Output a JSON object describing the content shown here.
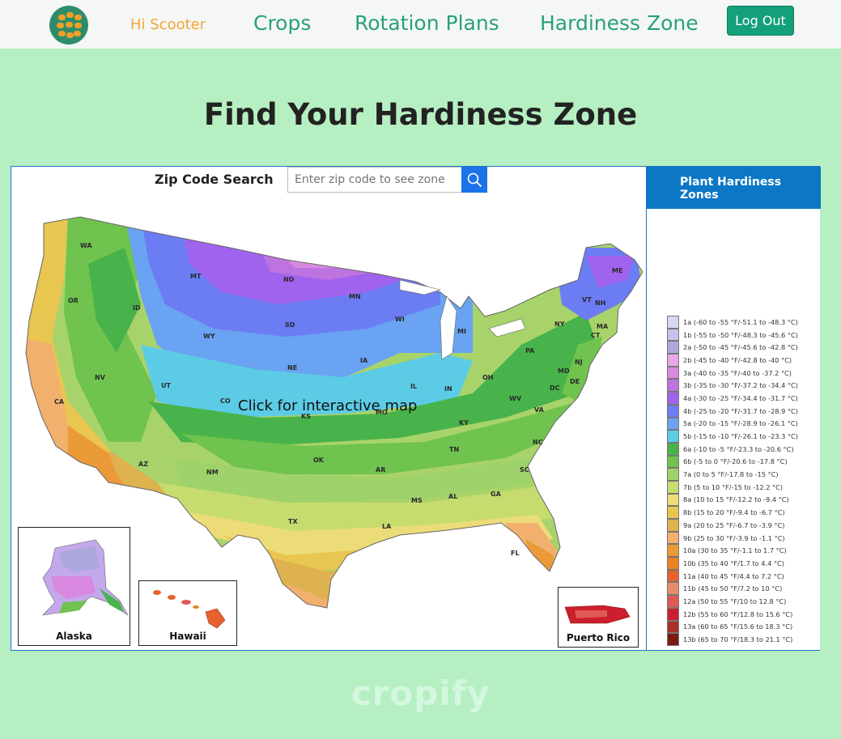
{
  "nav": {
    "greeting": "Hi Scooter",
    "links": [
      "Crops",
      "Rotation Plans",
      "Hardiness Zone"
    ],
    "logout_label": "Log Out"
  },
  "page": {
    "title": "Find Your Hardiness Zone"
  },
  "map": {
    "zip_label": "Zip Code Search",
    "zip_placeholder": "Enter zip code to see zone",
    "cta": "Click for interactive map",
    "insets": [
      "Alaska",
      "Hawaii",
      "Puerto Rico"
    ],
    "state_labels": [
      "WA",
      "OR",
      "CA",
      "NV",
      "ID",
      "MT",
      "WY",
      "UT",
      "AZ",
      "CO",
      "NM",
      "ND",
      "SD",
      "NE",
      "KS",
      "OK",
      "TX",
      "MN",
      "IA",
      "MO",
      "AR",
      "LA",
      "WI",
      "IL",
      "MS",
      "MI",
      "IN",
      "KY",
      "TN",
      "AL",
      "OH",
      "GA",
      "FL",
      "SC",
      "NC",
      "VA",
      "WV",
      "PA",
      "NY",
      "VT",
      "NH",
      "ME",
      "MA",
      "CT",
      "NJ",
      "DE",
      "MD",
      "DC"
    ]
  },
  "legend": {
    "title": "Plant Hardiness Zones",
    "items": [
      {
        "label": "1a (-60 to -55 °F/-51.1 to -48.3 °C)",
        "color": "#d6d8f3"
      },
      {
        "label": "1b (-55 to -50 °F/-48.3 to -45.6 °C)",
        "color": "#c4c4ea"
      },
      {
        "label": "2a (-50 to -45 °F/-45.6 to -42.8 °C)",
        "color": "#ada8dc"
      },
      {
        "label": "2b (-45 to -40 °F/-42.8 to -40 °C)",
        "color": "#e8a6e4"
      },
      {
        "label": "3a (-40 to -35 °F/-40 to -37.2 °C)",
        "color": "#d98ae0"
      },
      {
        "label": "3b (-35 to -30 °F/-37.2 to -34.4 °C)",
        "color": "#bd73e0"
      },
      {
        "label": "4a (-30 to -25 °F/-34.4 to -31.7 °C)",
        "color": "#a063ee"
      },
      {
        "label": "4b (-25 to -20 °F/-31.7 to -28.9 °C)",
        "color": "#6c7cf2"
      },
      {
        "label": "5a (-20 to -15 °F/-28.9 to -26.1 °C)",
        "color": "#69a3f2"
      },
      {
        "label": "5b (-15 to -10 °F/-26.1 to -23.3 °C)",
        "color": "#5ccbe6"
      },
      {
        "label": "6a (-10 to -5 °F/-23.3 to -20.6 °C)",
        "color": "#48b34a"
      },
      {
        "label": "6b (-5 to 0 °F/-20.6 to -17.8 °C)",
        "color": "#6fc34e"
      },
      {
        "label": "7a (0 to 5 °F/-17.8 to -15 °C)",
        "color": "#9fd26a"
      },
      {
        "label": "7b (5 to 10 °F/-15 to -12.2 °C)",
        "color": "#c6dc6e"
      },
      {
        "label": "8a (10 to 15 °F/-12.2 to -9.4 °C)",
        "color": "#ecdc78"
      },
      {
        "label": "8b (15 to 20 °F/-9.4 to -6.7 °C)",
        "color": "#e8c650"
      },
      {
        "label": "9a (20 to 25 °F/-6.7 to -3.9 °C)",
        "color": "#deb24e"
      },
      {
        "label": "9b (25 to 30 °F/-3.9 to -1.1 °C)",
        "color": "#f2b06e"
      },
      {
        "label": "10a (30 to 35 °F/-1.1 to 1.7 °C)",
        "color": "#eb9a38"
      },
      {
        "label": "10b (35 to 40 °F/1.7 to 4.4 °C)",
        "color": "#e88224"
      },
      {
        "label": "11a (40 to 45 °F/4.4 to 7.2 °C)",
        "color": "#e5622c"
      },
      {
        "label": "11b (45 to 50 °F/7.2 to 10 °C)",
        "color": "#e78b68"
      },
      {
        "label": "12a (50 to 55 °F/10 to 12.8 °C)",
        "color": "#df5a54"
      },
      {
        "label": "12b (55 to 60 °F/12.8 to 15.6 °C)",
        "color": "#cc1e2c"
      },
      {
        "label": "13a (60 to 65 °F/15.6 to 18.3 °C)",
        "color": "#a8322a"
      },
      {
        "label": "13b (65 to 70 °F/18.3 to 21.1 °C)",
        "color": "#7a1a12"
      }
    ]
  },
  "footer": {
    "brand": "cropify"
  }
}
